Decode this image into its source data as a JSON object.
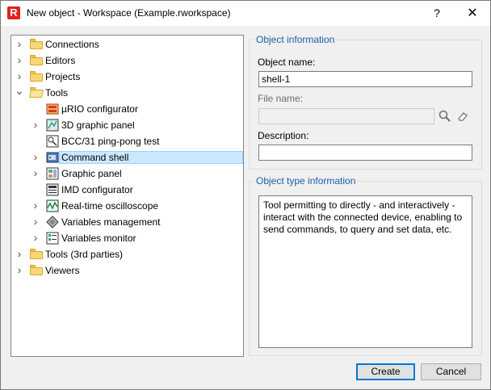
{
  "window": {
    "title": "New object - Workspace (Example.rworkspace)",
    "app_icon": "R",
    "help": "?",
    "close": "✕"
  },
  "tree": {
    "items": [
      {
        "label": "Connections",
        "icon": "folder-icon",
        "level": 0,
        "expand": "collapsed"
      },
      {
        "label": "Editors",
        "icon": "folder-icon",
        "level": 0,
        "expand": "collapsed"
      },
      {
        "label": "Projects",
        "icon": "folder-icon",
        "level": 0,
        "expand": "collapsed"
      },
      {
        "label": "Tools",
        "icon": "folder-open-icon",
        "level": 0,
        "expand": "expanded"
      },
      {
        "label": "µRIO configurator",
        "icon": "urio-icon",
        "level": 1,
        "expand": "none"
      },
      {
        "label": "3D graphic panel",
        "icon": "3d-panel-icon",
        "level": 1,
        "expand": "collapsed"
      },
      {
        "label": "BCC/31 ping-pong test",
        "icon": "ping-pong-icon",
        "level": 1,
        "expand": "none"
      },
      {
        "label": "Command shell",
        "icon": "command-shell-icon",
        "level": 1,
        "expand": "collapsed",
        "selected": true
      },
      {
        "label": "Graphic panel",
        "icon": "graphic-panel-icon",
        "level": 1,
        "expand": "collapsed"
      },
      {
        "label": "IMD configurator",
        "icon": "imd-icon",
        "level": 1,
        "expand": "none"
      },
      {
        "label": "Real-time oscilloscope",
        "icon": "oscilloscope-icon",
        "level": 1,
        "expand": "collapsed"
      },
      {
        "label": "Variables management",
        "icon": "variables-mgmt-icon",
        "level": 1,
        "expand": "collapsed"
      },
      {
        "label": "Variables monitor",
        "icon": "variables-monitor-icon",
        "level": 1,
        "expand": "collapsed"
      },
      {
        "label": "Tools (3rd parties)",
        "icon": "folder-icon",
        "level": 0,
        "expand": "collapsed"
      },
      {
        "label": "Viewers",
        "icon": "folder-icon",
        "level": 0,
        "expand": "collapsed"
      }
    ]
  },
  "object_info": {
    "title": "Object information",
    "name_label": "Object name:",
    "name_value": "shell-1",
    "file_label": "File name:",
    "file_value": "",
    "desc_label": "Description:",
    "desc_value": ""
  },
  "type_info": {
    "title": "Object type information",
    "text": "Tool permitting to directly - and interactively - interact with the connected device, enabling to send commands, to query and set data, etc."
  },
  "buttons": {
    "create": "Create",
    "cancel": "Cancel"
  },
  "colors": {
    "accent": "#0078d7",
    "selection": "#cce8ff",
    "group_title": "#1f5ea8",
    "app_icon": "#e2211c"
  }
}
